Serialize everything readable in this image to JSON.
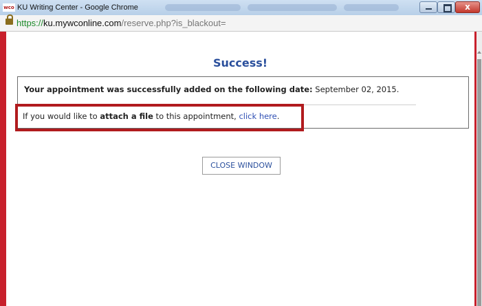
{
  "window": {
    "favicon_text": "wco",
    "title": "KU Writing Center - Google Chrome",
    "close_glyph": "x"
  },
  "address": {
    "scheme": "https://",
    "host": "ku.mywconline.com",
    "path": "/reserve.php?is_blackout="
  },
  "page": {
    "heading": "Success!",
    "line1_bold": "Your appointment was successfully added on the following date:",
    "line1_date": " September 02, 2015.",
    "line2_pre": "If you would like to ",
    "line2_bold": "attach a file",
    "line2_mid": " to this appointment, ",
    "line2_link": "click here",
    "line2_end": ".",
    "close_button": "CLOSE WINDOW"
  },
  "colors": {
    "heading": "#2a4f9c",
    "link": "#3050b4",
    "highlight_border": "#b11b1e",
    "window_edge": "#c8202c"
  }
}
